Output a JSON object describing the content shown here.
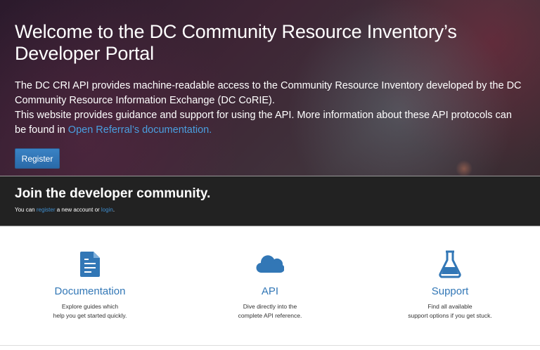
{
  "hero": {
    "title_line1": "Welcome to the DC Community Resource Inventory’s",
    "title_line2": "Developer Portal",
    "p1": "The DC CRI API provides machine-readable access to the Community Resource Inventory developed by the DC Community Resource Information Exchange (DC CoRIE).",
    "p2": "This website provides guidance and support for using the API. More information about these API protocols can be found in ",
    "p2_link": "Open Referral’s documentation.",
    "register": "Register"
  },
  "community": {
    "title": "Join the developer community.",
    "pre": "You can ",
    "register": "register",
    "mid": " a new account or ",
    "login": "login",
    "post": "."
  },
  "features": [
    {
      "icon": "document-icon",
      "title": "Documentation",
      "line1": "Explore guides which",
      "line2": "help you get started quickly."
    },
    {
      "icon": "cloud-icon",
      "title": "API",
      "line1": "Dive directly into the",
      "line2": "complete API reference."
    },
    {
      "icon": "flask-icon",
      "title": "Support",
      "line1": "Find all available",
      "line2": "support options if you get stuck."
    }
  ],
  "colors": {
    "accent": "#3277b6",
    "band": "#222222"
  }
}
